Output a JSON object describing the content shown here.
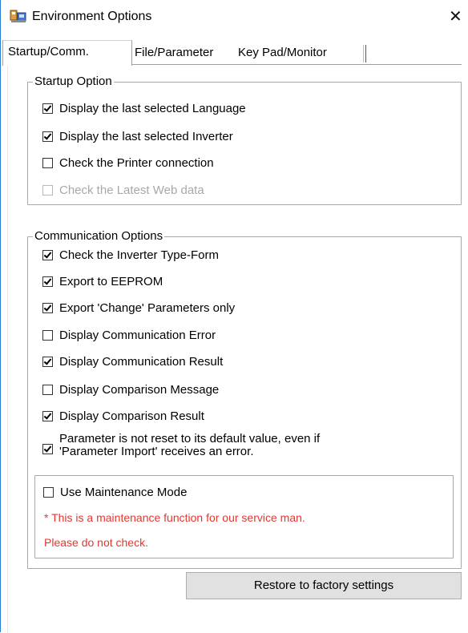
{
  "window": {
    "title": "Environment Options",
    "close_glyph": "✕",
    "app_icon": "environment-options-icon"
  },
  "tabs": [
    {
      "label": "Startup/Comm.",
      "active": true
    },
    {
      "label": "File/Parameter",
      "active": false
    },
    {
      "label": "Key Pad/Monitor",
      "active": false
    }
  ],
  "startup": {
    "title": "Startup Option",
    "items": [
      {
        "label": "Display the last selected Language",
        "checked": true,
        "enabled": true
      },
      {
        "label": "Display the last selected Inverter",
        "checked": true,
        "enabled": true
      },
      {
        "label": "Check the Printer connection",
        "checked": false,
        "enabled": true
      },
      {
        "label": "Check the Latest Web data",
        "checked": false,
        "enabled": false
      }
    ]
  },
  "communication": {
    "title": "Communication Options",
    "items": [
      {
        "label": "Check the Inverter Type-Form",
        "checked": true
      },
      {
        "label": "Export to EEPROM",
        "checked": true
      },
      {
        "label": "Export 'Change' Parameters only",
        "checked": true
      },
      {
        "label": "Display Communication Error",
        "checked": false
      },
      {
        "label": "Display Communication Result",
        "checked": true
      },
      {
        "label": "Display Comparison Message",
        "checked": false
      },
      {
        "label": "Display Comparison Result",
        "checked": true
      }
    ],
    "reset_item": {
      "line1": "Parameter is not reset to its default value, even if",
      "line2": "'Parameter Import' receives an error.",
      "checked": true
    },
    "maintenance": {
      "label": "Use Maintenance Mode",
      "checked": false,
      "note1": "* This is a maintenance function for our service man.",
      "note2": "Please do not check."
    }
  },
  "buttons": {
    "restore": "Restore to factory settings"
  },
  "colors": {
    "warning_text": "#e8352b",
    "button_face": "#e1e1e1",
    "window_border": "#2a7fd4"
  }
}
